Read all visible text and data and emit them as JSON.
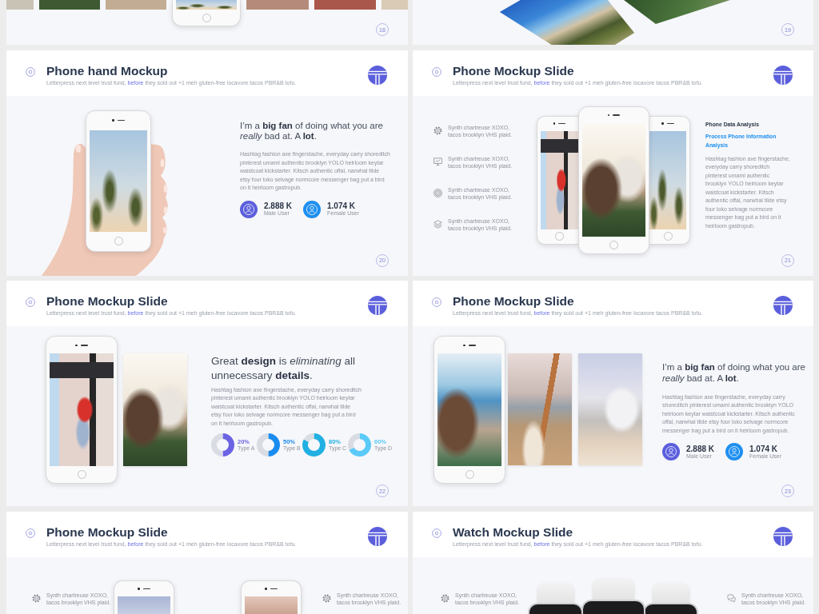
{
  "slides": [
    {
      "kind": "strip",
      "number": "18"
    },
    {
      "kind": "tilted",
      "number": "19"
    },
    {
      "kind": "hand",
      "title": "Phone hand Mockup",
      "subtitle": {
        "lead": "Letterpress next level trust fund,",
        "link": "before",
        "tail": "they sold out +1 meh gluten-free locavore tacos PBR&B tofu."
      },
      "heading": "I’m a **big fan** of doing what you are *really* bad at. A **lot**.",
      "body": "Hashtag fashion axe fingerstache, everyday carry shoreditch pinterest umami authentic brooklyn YOLO heirloom keytar waistcoat kickstarter. Kitsch authentic offal, narwhal tilde etsy four loko selvage normcore messenger bag put a bird on it heirloom gastropub.",
      "stats": [
        {
          "value": "2.888 K",
          "label": "Male User",
          "color": "#5b5fdc"
        },
        {
          "value": "1.074 K",
          "label": "Female User",
          "color": "#1e8ff0"
        }
      ],
      "number": "20"
    },
    {
      "kind": "trio",
      "title": "Phone Mockup Slide",
      "subtitle": {
        "lead": "Letterpress next level trust fund,",
        "link": "before",
        "tail": "they sold out +1 meh gluten-free locavore tacos PBR&B tofu."
      },
      "features": [
        "Synth chartreuse XOXO, tacos brooklyn VHS plaid.",
        "Synth chartreuse XOXO, tacos brooklyn VHS plaid.",
        "Synth chartreuse XOXO, tacos brooklyn VHS plaid.",
        "Synth chartreuse XOXO, tacos brooklyn VHS plaid."
      ],
      "side_title": "Phone Data Analysis",
      "side_subtitle": "Process Phone Information Analysis",
      "body": "Hashtag fashion axe fingerstache, everyday carry shoreditch pinterest umami authentic brooklyn YOLO heirloom keytar waistcoat kickstarter. Kitsch authentic offal, narwhal tilde etsy four loko selvage normcore messenger bag put a bird on it heirloom gastropub.",
      "number": "21"
    },
    {
      "kind": "donuts",
      "title": "Phone Mockup Slide",
      "subtitle": {
        "lead": "Letterpress next level trust fund,",
        "link": "before",
        "tail": "they sold out +1 meh gluten-free locavore tacos PBR&B tofu."
      },
      "heading": "Great **design** is *eliminating* all unnecessary **details**.",
      "body": "Hashtag fashion axe fingerstache, everyday carry shoreditch pinterest umami authentic brooklyn YOLO heirloom keytar waistcoat kickstarter. Kitsch authentic offal, narwhal tilde etsy four loko selvage normcore messenger bag put a bird on it heirloom gastropub.",
      "rings": [
        {
          "value": "20%",
          "label": "Type A",
          "color": "#6b63e3",
          "chart_data": {
            "type": "donut",
            "values": [
              50,
              50
            ]
          }
        },
        {
          "value": "50%",
          "label": "Type B",
          "color": "#1a8cf0",
          "chart_data": {
            "type": "donut",
            "values": [
              50,
              50
            ]
          }
        },
        {
          "value": "80%",
          "label": "Type C",
          "color": "#22b0e2",
          "chart_data": {
            "type": "donut",
            "values": [
              83,
              17
            ]
          }
        },
        {
          "value": "60%",
          "label": "Type D",
          "color": "#5ccaf8",
          "chart_data": {
            "type": "donut",
            "values": [
              68,
              32
            ]
          }
        }
      ],
      "number": "22"
    },
    {
      "kind": "gallery",
      "title": "Phone Mockup Slide",
      "subtitle": {
        "lead": "Letterpress next level trust fund,",
        "link": "before",
        "tail": "they sold out +1 meh gluten-free locavore tacos PBR&B tofu."
      },
      "heading": "I’m a **big fan** of doing what you are *really* bad at. A **lot**.",
      "body": "Hashtag fashion axe fingerstache, everyday carry shoreditch pinterest umami authentic brooklyn YOLO heirloom keytar waistcoat kickstarter. Kitsch authentic offal, narwhal tilde etsy four loko selvage normcore messenger bag put a bird on it heirloom gastropub.",
      "stats": [
        {
          "value": "2.888 K",
          "label": "Male User",
          "color": "#5b5fdc"
        },
        {
          "value": "1.074 K",
          "label": "Female User",
          "color": "#1e8ff0"
        }
      ],
      "number": "23"
    },
    {
      "kind": "phones",
      "title": "Phone Mockup Slide",
      "subtitle": {
        "lead": "Letterpress next level trust fund,",
        "link": "before",
        "tail": "they sold out +1 meh gluten-free locavore tacos PBR&B tofu."
      },
      "features": [
        "Synth chartreuse XOXO, tacos brooklyn VHS plaid.",
        "Synth chartreuse XOXO, tacos brooklyn VHS plaid."
      ]
    },
    {
      "kind": "watches",
      "title": "Watch Mockup Slide",
      "subtitle": {
        "lead": "Letterpress next level trust fund,",
        "link": "before",
        "tail": "they sold out +1 meh gluten-free locavore tacos PBR&B tofu."
      },
      "features": [
        "Synth chartreuse XOXO, tacos brooklyn VHS plaid.",
        "Synth chartreuse XOXO, tacos brooklyn VHS plaid."
      ]
    }
  ]
}
